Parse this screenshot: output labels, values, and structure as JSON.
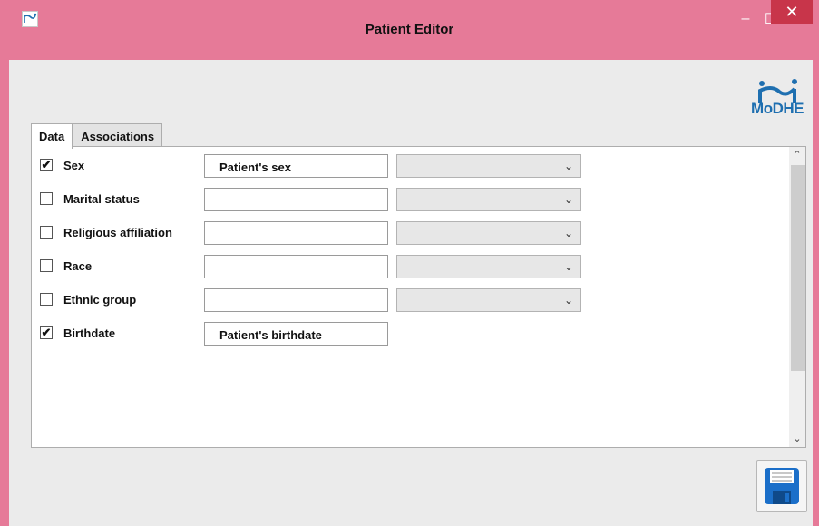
{
  "window": {
    "title": "Patient Editor",
    "controls": {
      "minimize": "–",
      "maximize": "☐",
      "close": "✕"
    }
  },
  "logo": {
    "text": "MoDHE"
  },
  "tabs": [
    {
      "label": "Data",
      "active": true
    },
    {
      "label": "Associations",
      "active": false
    }
  ],
  "rows": [
    {
      "label": "Sex",
      "checked": true,
      "text_value": "Patient's sex",
      "has_select": true,
      "select_value": ""
    },
    {
      "label": "Marital status",
      "checked": false,
      "text_value": "",
      "has_select": true,
      "select_value": ""
    },
    {
      "label": "Religious affiliation",
      "checked": false,
      "text_value": "",
      "has_select": true,
      "select_value": ""
    },
    {
      "label": "Race",
      "checked": false,
      "text_value": "",
      "has_select": true,
      "select_value": ""
    },
    {
      "label": "Ethnic group",
      "checked": false,
      "text_value": "",
      "has_select": true,
      "select_value": ""
    },
    {
      "label": "Birthdate",
      "checked": true,
      "text_value": "Patient's birthdate",
      "has_select": false
    }
  ],
  "icons": {
    "app": "app-logo-icon",
    "save": "floppy-disk-icon",
    "chevron": "chevron-down-icon"
  },
  "colors": {
    "titlebar": "#e67a98",
    "close_button": "#c8354a",
    "logo_blue": "#1e6fb0"
  }
}
